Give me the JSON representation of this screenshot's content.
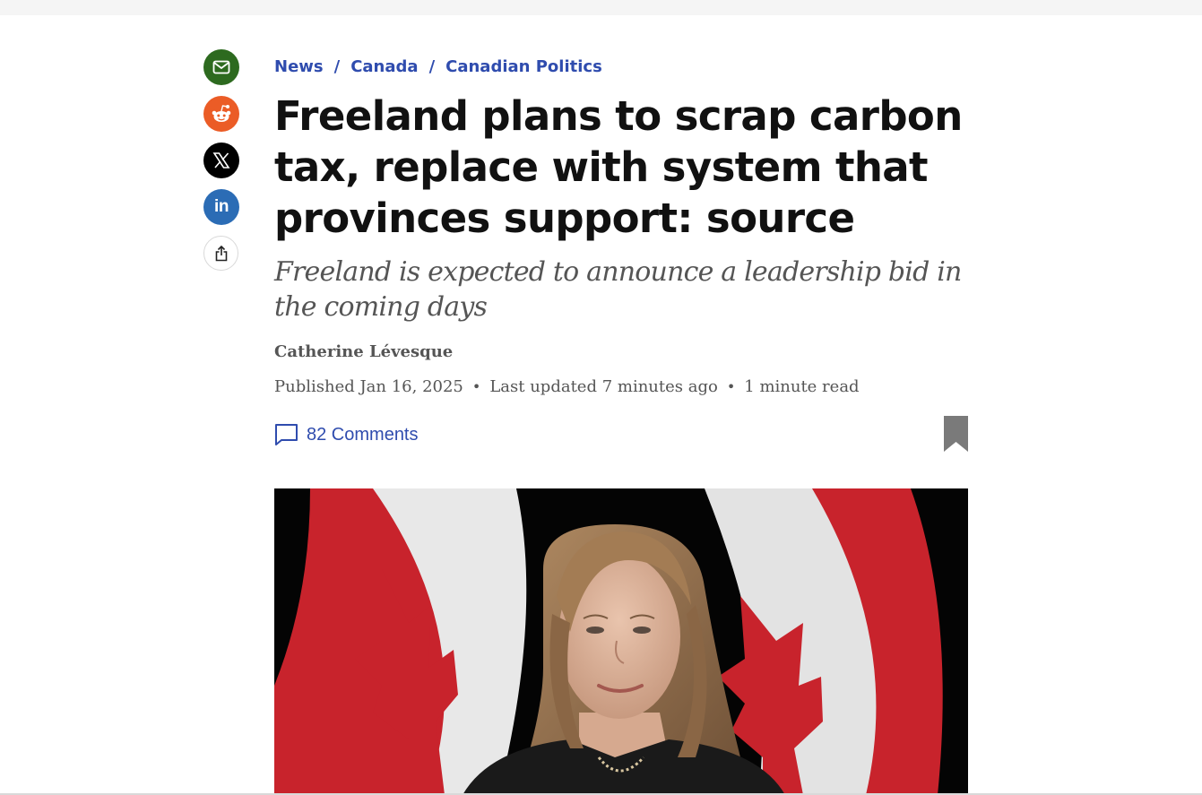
{
  "breadcrumb": [
    {
      "label": "News"
    },
    {
      "label": "Canada"
    },
    {
      "label": "Canadian Politics"
    }
  ],
  "breadcrumb_separator": "/",
  "headline": "Freeland plans to scrap carbon tax, replace with system that provinces support: source",
  "dek": "Freeland is expected to announce a leadership bid in the coming days",
  "author": "Catherine Lévesque",
  "meta": {
    "published": "Published Jan 16, 2025",
    "updated": "Last updated 7 minutes ago",
    "read_time": "1 minute read",
    "separator": "•"
  },
  "comments_label": "82 Comments",
  "share_icons": [
    "email-icon",
    "reddit-icon",
    "x-icon",
    "linkedin-icon",
    "share-icon"
  ],
  "share": {
    "linkedin_text": "in"
  },
  "colors": {
    "link_blue": "#2f4cae",
    "email_green": "#2d6a1f",
    "reddit_orange": "#eb5c26",
    "x_black": "#000000",
    "linkedin_blue": "#2b6cb5",
    "bookmark_gray": "#7a7a7a",
    "flag_red": "#c8232c"
  },
  "hero_image": {
    "subject": "woman-with-canadian-flags"
  }
}
